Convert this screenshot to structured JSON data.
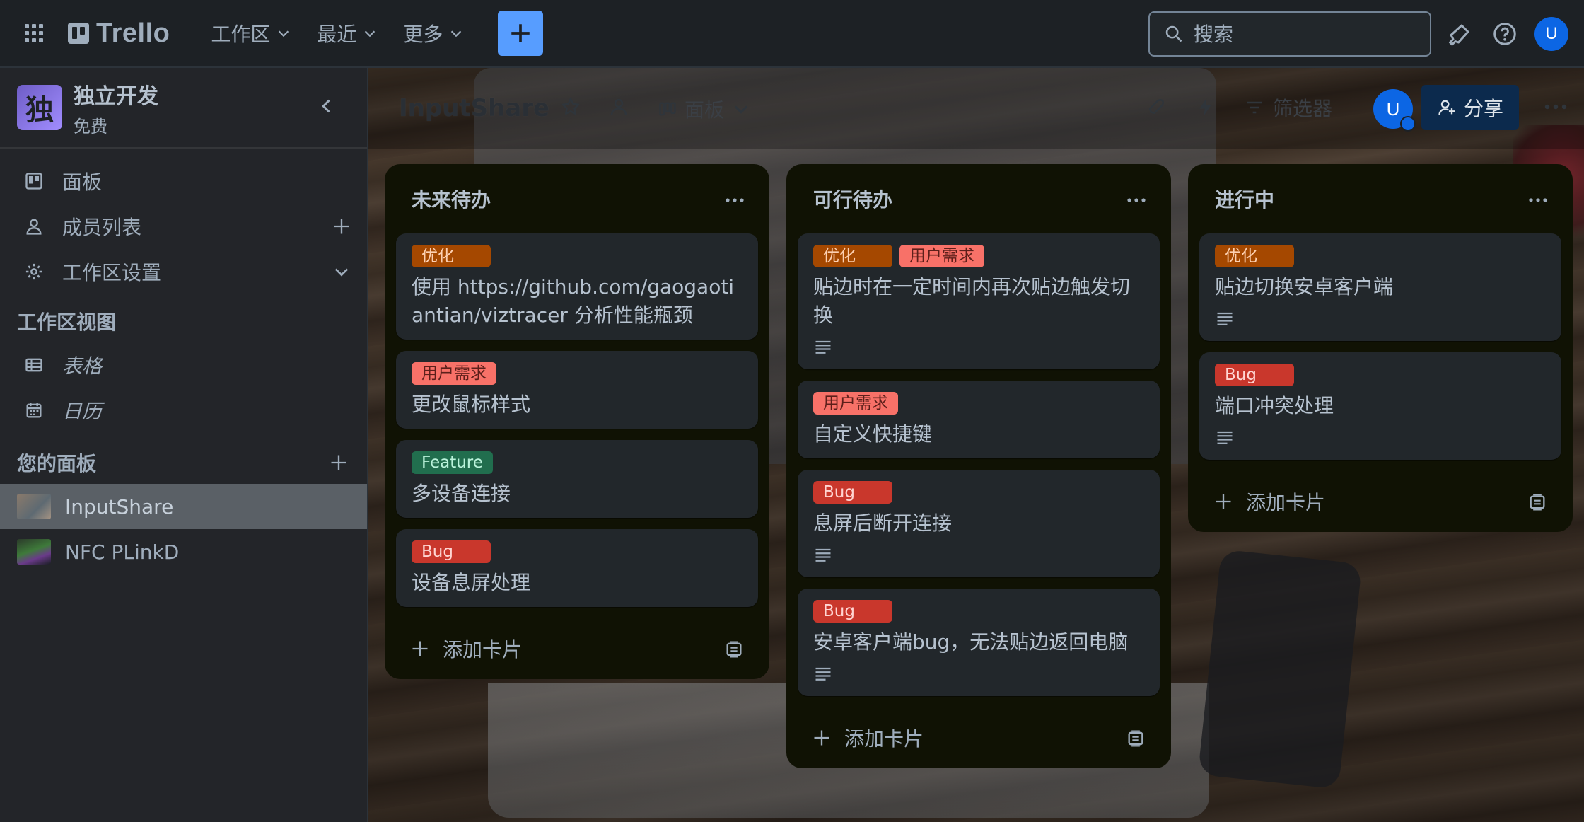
{
  "topnav": {
    "app_name": "Trello",
    "menus": [
      {
        "label": "工作区"
      },
      {
        "label": "最近"
      },
      {
        "label": "更多"
      }
    ],
    "search_placeholder": "搜索",
    "avatar_initial": "U"
  },
  "sidebar": {
    "workspace_badge": "独",
    "workspace_name": "独立开发",
    "workspace_plan": "免费",
    "items": [
      {
        "label": "面板",
        "icon": "board-icon"
      },
      {
        "label": "成员列表",
        "icon": "person-icon"
      },
      {
        "label": "工作区设置",
        "icon": "gear-icon"
      }
    ],
    "views_heading": "工作区视图",
    "views": [
      {
        "label": "表格",
        "icon": "table-icon"
      },
      {
        "label": "日历",
        "icon": "calendar-icon"
      }
    ],
    "boards_heading": "您的面板",
    "boards": [
      {
        "label": "InputShare",
        "active": true
      },
      {
        "label": "NFC PLinkD",
        "active": false
      }
    ]
  },
  "board": {
    "title": "InputShare",
    "view_label": "面板",
    "filter_label": "筛选器",
    "avatar_initial": "U",
    "share_label": "分享"
  },
  "label_colors": {
    "优化": "#a54800",
    "用户需求": "#f87168",
    "Feature": "#216e4e",
    "Bug": "#c9372c"
  },
  "lists": [
    {
      "title": "未来待办",
      "add_label": "添加卡片",
      "cards": [
        {
          "labels": [
            "优化"
          ],
          "title": "使用 https://github.com/gaogaotiantian/viztracer 分析性能瓶颈",
          "has_description": false
        },
        {
          "labels": [
            "用户需求"
          ],
          "title": "更改鼠标样式",
          "has_description": false
        },
        {
          "labels": [
            "Feature"
          ],
          "title": "多设备连接",
          "has_description": false
        },
        {
          "labels": [
            "Bug"
          ],
          "title": "设备息屏处理",
          "has_description": false
        }
      ]
    },
    {
      "title": "可行待办",
      "add_label": "添加卡片",
      "cards": [
        {
          "labels": [
            "优化",
            "用户需求"
          ],
          "title": "贴边时在一定时间内再次贴边触发切换",
          "has_description": true
        },
        {
          "labels": [
            "用户需求"
          ],
          "title": "自定义快捷键",
          "has_description": false
        },
        {
          "labels": [
            "Bug"
          ],
          "title": "息屏后断开连接",
          "has_description": true
        },
        {
          "labels": [
            "Bug"
          ],
          "title": "安卓客户端bug，无法贴边返回电脑",
          "has_description": true
        }
      ]
    },
    {
      "title": "进行中",
      "add_label": "添加卡片",
      "cards": [
        {
          "labels": [
            "优化"
          ],
          "title": "贴边切换安卓客户端",
          "has_description": true
        },
        {
          "labels": [
            "Bug"
          ],
          "title": "端口冲突处理",
          "has_description": true
        }
      ]
    }
  ]
}
